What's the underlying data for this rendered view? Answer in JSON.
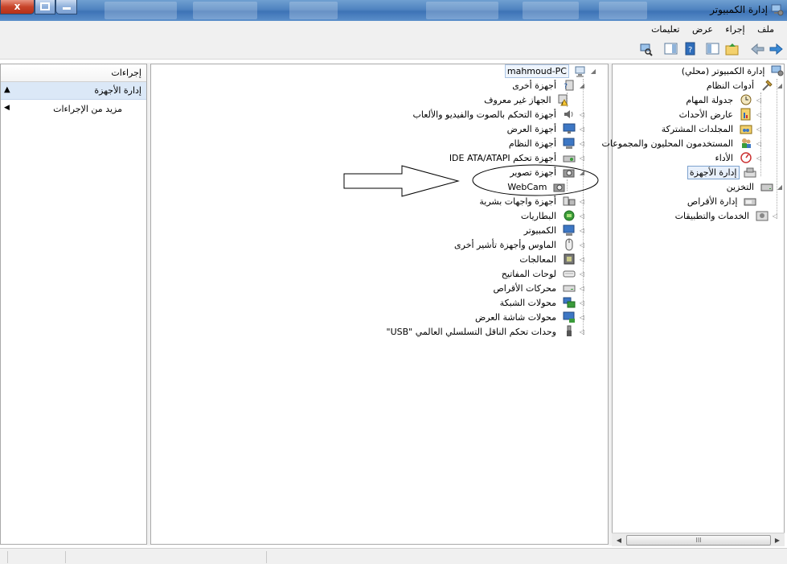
{
  "window": {
    "title": "إدارة الكمبيوتر",
    "controls": {
      "close": "x"
    }
  },
  "menu": [
    "ملف",
    "إجراء",
    "عرض",
    "تعليمات"
  ],
  "actions": {
    "header": "إجراءات",
    "group": "إدارة الأجهزة",
    "more": "مزيد من الإجراءات"
  },
  "left_tree": {
    "root": "إدارة الكمبيوتر (محلي)",
    "system_tools": "أدوات النظام",
    "items": [
      "جدولة المهام",
      "عارض الأحداث",
      "المجلدات المشتركة",
      "المستخدمون المحليون والمجموعات",
      "الأداء",
      "إدارة الأجهزة"
    ],
    "storage": "التخزين",
    "disk_management": "إدارة الأقراص",
    "services": "الخدمات والتطبيقات"
  },
  "devices": {
    "computer_name": "mahmoud-PC",
    "categories": [
      "أجهزة أخرى",
      "الجهاز غير معروف",
      "أجهزة التحكم بالصوت والفيديو والألعاب",
      "أجهزة العرض",
      "أجهزة النظام",
      "أجهزة تحكم IDE ATA/ATAPI",
      "أجهزة تصوير",
      "WebCam",
      "أجهزة واجهات بشرية",
      "البطاريات",
      "الكمبيوتر",
      "الماوس وأجهزة تأشير أخرى",
      "المعالجات",
      "لوحات المفاتيح",
      "محركات الأقراص",
      "محولات الشبكة",
      "محولات شاشة العرض",
      "وحدات تحكم الناقل التسلسلي العالمي \"USB\""
    ]
  },
  "scrollbar": {
    "thumb_label": "III"
  }
}
